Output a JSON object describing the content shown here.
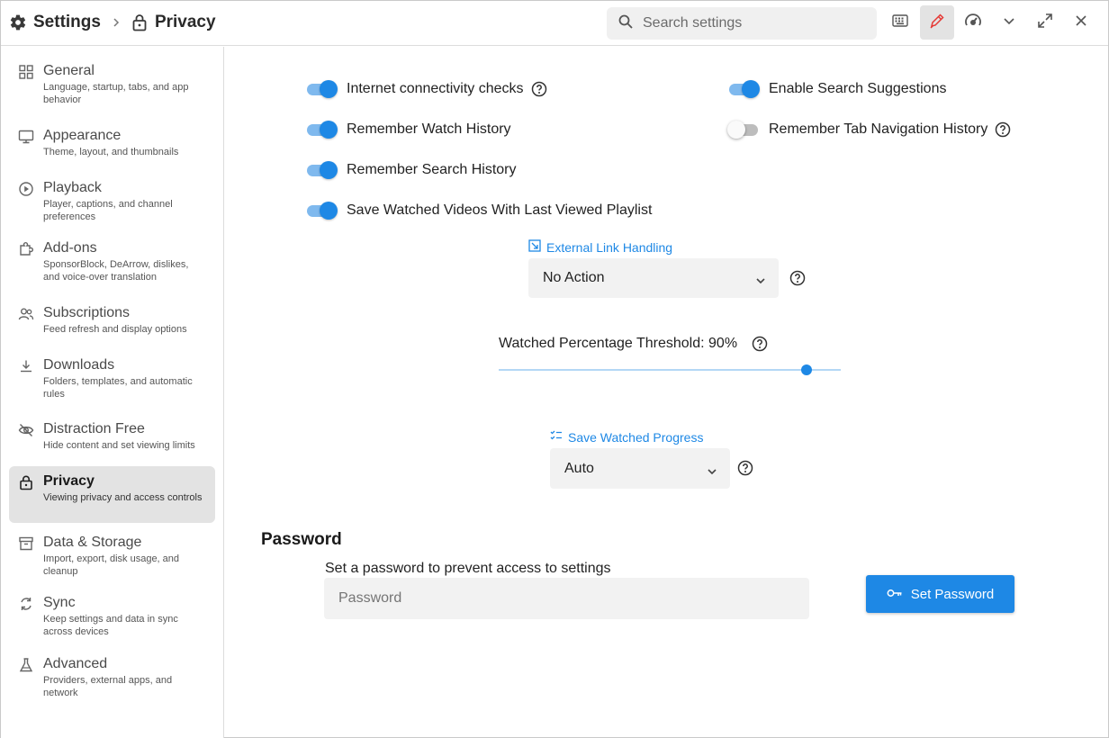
{
  "header": {
    "breadcrumb_root": "Settings",
    "breadcrumb_current": "Privacy",
    "search_placeholder": "Search settings"
  },
  "sidebar": {
    "items": [
      {
        "title": "General",
        "desc": "Language, startup, tabs, and app behavior",
        "icon": "grid-icon"
      },
      {
        "title": "Appearance",
        "desc": "Theme, layout, and thumbnails",
        "icon": "monitor-icon"
      },
      {
        "title": "Playback",
        "desc": "Player, captions, and channel preferences",
        "icon": "play-circle-icon"
      },
      {
        "title": "Add-ons",
        "desc": "SponsorBlock, DeArrow, dislikes, and voice-over translation",
        "icon": "puzzle-icon"
      },
      {
        "title": "Subscriptions",
        "desc": "Feed refresh and display options",
        "icon": "people-icon"
      },
      {
        "title": "Downloads",
        "desc": "Folders, templates, and automatic rules",
        "icon": "download-icon"
      },
      {
        "title": "Distraction Free",
        "desc": "Hide content and set viewing limits",
        "icon": "eye-off-icon"
      },
      {
        "title": "Privacy",
        "desc": "Viewing privacy and access controls",
        "icon": "lock-icon",
        "active": true
      },
      {
        "title": "Data & Storage",
        "desc": "Import, export, disk usage, and cleanup",
        "icon": "archive-icon"
      },
      {
        "title": "Sync",
        "desc": "Keep settings and data in sync across devices",
        "icon": "sync-icon"
      },
      {
        "title": "Advanced",
        "desc": "Providers, external apps, and network",
        "icon": "flask-icon"
      }
    ]
  },
  "toggles": {
    "internet_checks": {
      "label": "Internet connectivity checks",
      "on": true
    },
    "search_suggestions": {
      "label": "Enable Search Suggestions",
      "on": true
    },
    "watch_history": {
      "label": "Remember Watch History",
      "on": true
    },
    "tab_nav_history": {
      "label": "Remember Tab Navigation History",
      "on": false
    },
    "search_history": {
      "label": "Remember Search History",
      "on": true
    },
    "save_watched_playlist": {
      "label": "Save Watched Videos With Last Viewed Playlist",
      "on": true
    }
  },
  "external_link": {
    "label": "External Link Handling",
    "value": "No Action"
  },
  "threshold": {
    "label": "Watched Percentage Threshold: 90%",
    "value_percent": 90
  },
  "save_progress": {
    "label": "Save Watched Progress",
    "value": "Auto"
  },
  "password": {
    "section_title": "Password",
    "description": "Set a password to prevent access to settings",
    "placeholder": "Password",
    "button_label": "Set Password"
  },
  "colors": {
    "accent": "#1e88e5",
    "active_bg": "#e3e3e3"
  }
}
